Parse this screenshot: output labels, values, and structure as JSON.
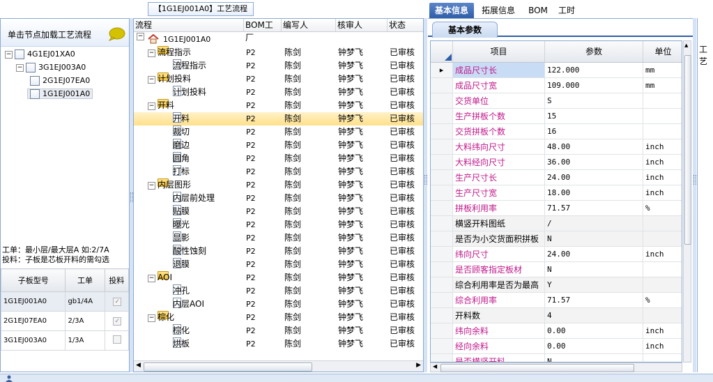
{
  "left": {
    "header": "单击节点加载工艺流程",
    "tree": [
      "4G1EJ01XA0",
      "3G1EJ003A0",
      "2G1EJ07EA0",
      "1G1EJ001A0"
    ],
    "note_line1": "工单：最小层/最大层A 如:2/7A",
    "note_line2": "投料：子板是芯板开料的需勾选",
    "table": {
      "headers": [
        "子板型号",
        "工单",
        "投料"
      ],
      "rows": [
        {
          "model": "1G1EJ001A0",
          "order": "gb1/4A",
          "checked": true
        },
        {
          "model": "2G1EJ07EA0",
          "order": "2/3A",
          "checked": true
        },
        {
          "model": "3G1EJ003A0",
          "order": "1/3A",
          "checked": false
        }
      ]
    }
  },
  "middle": {
    "title": "【1G1EJ001A0】工艺流程",
    "headers": [
      "流程",
      "BOM工厂",
      "编写人",
      "核审人",
      "状态"
    ],
    "root": "1G1EJ001A0",
    "rows": [
      {
        "name": "流程指示",
        "level": 1,
        "folder": true
      },
      {
        "name": "流程指示",
        "level": 2,
        "folder": false
      },
      {
        "name": "计划投料",
        "level": 1,
        "folder": true
      },
      {
        "name": "计划投料",
        "level": 2,
        "folder": false
      },
      {
        "name": "开料",
        "level": 1,
        "folder": true
      },
      {
        "name": "开料",
        "level": 2,
        "folder": false,
        "selected": true
      },
      {
        "name": "裁切",
        "level": 2,
        "folder": false
      },
      {
        "name": "磨边",
        "level": 2,
        "folder": false
      },
      {
        "name": "圆角",
        "level": 2,
        "folder": false
      },
      {
        "name": "打标",
        "level": 2,
        "folder": false
      },
      {
        "name": "内层图形",
        "level": 1,
        "folder": true
      },
      {
        "name": "内层前处理",
        "level": 2,
        "folder": false
      },
      {
        "name": "贴膜",
        "level": 2,
        "folder": false
      },
      {
        "name": "曝光",
        "level": 2,
        "folder": false
      },
      {
        "name": "显影",
        "level": 2,
        "folder": false
      },
      {
        "name": "酸性蚀刻",
        "level": 2,
        "folder": false
      },
      {
        "name": "退膜",
        "level": 2,
        "folder": false
      },
      {
        "name": "AOI",
        "level": 1,
        "folder": true
      },
      {
        "name": "冲孔",
        "level": 2,
        "folder": false
      },
      {
        "name": "内层AOI",
        "level": 2,
        "folder": false
      },
      {
        "name": "棕化",
        "level": 1,
        "folder": true
      },
      {
        "name": "棕化",
        "level": 2,
        "folder": false
      },
      {
        "name": "烘板",
        "level": 2,
        "folder": false
      }
    ],
    "factory": "P2",
    "writer": "陈剑",
    "reviewer": "钟梦飞",
    "status": "已审核"
  },
  "right": {
    "tabs": [
      "基本信息",
      "拓展信息",
      "BOM",
      "工时"
    ],
    "sub_tab": "基本参数",
    "headers": [
      "项目",
      "参数",
      "单位"
    ],
    "rows": [
      {
        "name": "成品尺寸长",
        "value": "122.000",
        "unit": "mm",
        "pink": true
      },
      {
        "name": "成品尺寸宽",
        "value": "109.000",
        "unit": "mm",
        "pink": true
      },
      {
        "name": "交货单位",
        "value": "S",
        "unit": "",
        "pink": true
      },
      {
        "name": "生产拼板个数",
        "value": "15",
        "unit": "",
        "pink": true
      },
      {
        "name": "交货拼板个数",
        "value": "16",
        "unit": "",
        "pink": true
      },
      {
        "name": "大料纬向尺寸",
        "value": "48.00",
        "unit": "inch",
        "pink": true
      },
      {
        "name": "大料经向尺寸",
        "value": "36.00",
        "unit": "inch",
        "pink": true
      },
      {
        "name": "生产尺寸长",
        "value": "24.00",
        "unit": "inch",
        "pink": true
      },
      {
        "name": "生产尺寸宽",
        "value": "18.00",
        "unit": "inch",
        "pink": true
      },
      {
        "name": "拼板利用率",
        "value": "71.57",
        "unit": "%",
        "pink": true
      },
      {
        "name": "横竖开料图纸",
        "value": "/",
        "unit": "",
        "pink": false
      },
      {
        "name": "是否为小交货面积拼板",
        "value": "N",
        "unit": "",
        "pink": false
      },
      {
        "name": "纬向尺寸",
        "value": "24.00",
        "unit": "inch",
        "pink": true
      },
      {
        "name": "是否顾客指定板材",
        "value": "N",
        "unit": "",
        "pink": true
      },
      {
        "name": "综合利用率是否为最高",
        "value": "Y",
        "unit": "",
        "pink": false
      },
      {
        "name": "综合利用率",
        "value": "71.57",
        "unit": "%",
        "pink": true
      },
      {
        "name": "开料数",
        "value": "4",
        "unit": "",
        "pink": false
      },
      {
        "name": "纬向余料",
        "value": "0.00",
        "unit": "inch",
        "pink": true
      },
      {
        "name": "经向余料",
        "value": "0.00",
        "unit": "inch",
        "pink": true
      },
      {
        "name": "是否横竖开料",
        "value": "N",
        "unit": "",
        "pink": true
      }
    ]
  },
  "far_right_label": "工艺"
}
